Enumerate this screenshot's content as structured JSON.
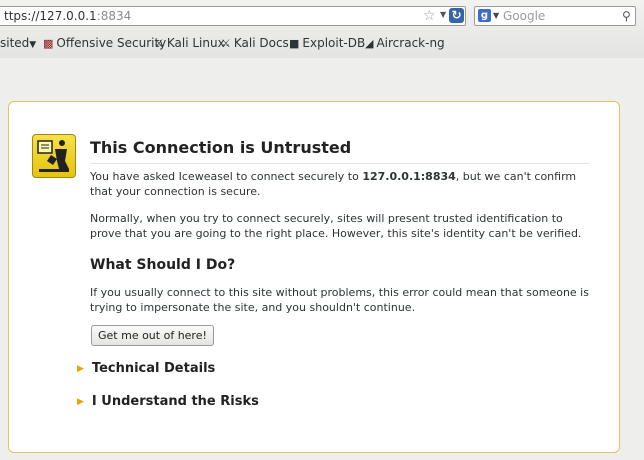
{
  "toolbar": {
    "url_scheme": "ttps://",
    "url_host": "127.0.0.1",
    "url_port": ":8834",
    "search_placeholder": "Google"
  },
  "bookmarks": [
    {
      "label": "sited",
      "icon": "dropdown-arrow"
    },
    {
      "label": "Offensive Security",
      "icon": "offsec-icon"
    },
    {
      "label": "Kali Linux",
      "icon": "kali-dragon-icon"
    },
    {
      "label": "Kali Docs",
      "icon": "kali-dragon-icon"
    },
    {
      "label": "Exploit-DB",
      "icon": "exploitdb-icon"
    },
    {
      "label": "Aircrack-ng",
      "icon": "aircrack-icon"
    }
  ],
  "error": {
    "title": "This Connection is Untrusted",
    "p1_before": "You have asked Iceweasel to connect securely to ",
    "p1_host": "127.0.0.1:8834",
    "p1_after": ", but we can't confirm that your connection is secure.",
    "p2": "Normally, when you try to connect securely, sites will present trusted identification to prove that you are going to the right place. However, this site's identity can't be verified.",
    "heading2": "What Should I Do?",
    "p3": "If you usually connect to this site without problems, this error could mean that someone is trying to impersonate the site, and you shouldn't continue.",
    "button_label": "Get me out of here!",
    "technical_details": "Technical Details",
    "understand_risks": "I Understand the Risks"
  },
  "colors": {
    "warning_border": "#ddc468",
    "warning_icon": "#f6e04a",
    "expander_triangle": "#e8a400"
  }
}
